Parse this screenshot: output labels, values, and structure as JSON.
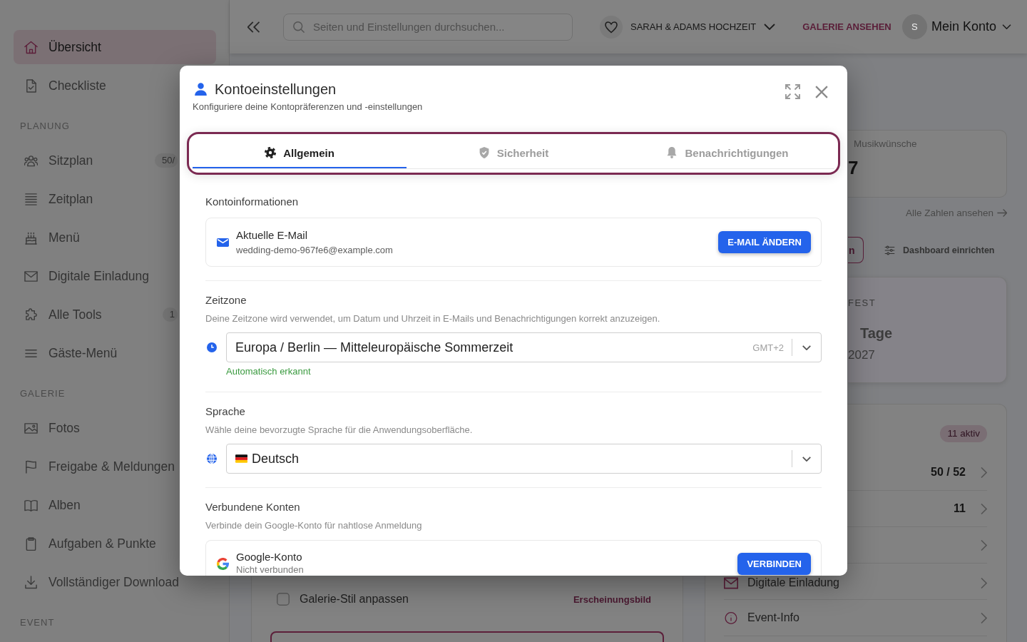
{
  "sidebar": {
    "sections": [
      {
        "items": [
          {
            "label": "Übersicht",
            "selected": true
          },
          {
            "label": "Checkliste",
            "selected": false
          }
        ]
      },
      {
        "heading": "PLANUNG",
        "items": [
          {
            "label": "Sitzplan",
            "selected": false,
            "badge": "50/"
          },
          {
            "label": "Zeitplan",
            "selected": false
          },
          {
            "label": "Menü",
            "selected": false
          },
          {
            "label": "Digitale Einladung",
            "selected": false
          },
          {
            "label": "Alle Tools",
            "selected": false,
            "badge": "1"
          },
          {
            "label": "Gäste-Menü",
            "selected": false
          }
        ]
      },
      {
        "heading": "GALERIE",
        "items": [
          {
            "label": "Fotos",
            "selected": false
          },
          {
            "label": "Freigabe & Meldungen",
            "selected": false
          },
          {
            "label": "Alben",
            "selected": false
          },
          {
            "label": "Aufgaben & Punkte",
            "selected": false
          },
          {
            "label": "Vollständiger Download",
            "selected": false
          }
        ]
      },
      {
        "heading": "EVENT"
      }
    ]
  },
  "topbar": {
    "search": {
      "placeholder": "Seiten und Einstellungen durchsuchen..."
    },
    "event": "SARAH & ADAMS HOCHZEIT",
    "gallery_link": "GALERIE ANSEHEN",
    "account": {
      "initial": "S",
      "label": "Mein Konto"
    }
  },
  "dashboard": {
    "stat": {
      "label": "Musikwünsche",
      "value": "7"
    },
    "all_stats_link": "Alle Zahlen ansehen",
    "partial_button": "n",
    "customize_button": "Dashboard einrichten",
    "countdown": {
      "label": "FEST",
      "unit": "Tage",
      "date": "2027"
    },
    "overview": {
      "badge": "11 aktiv",
      "rows": [
        {
          "value": "50 / 52"
        },
        {
          "value": "11"
        },
        {},
        {
          "label": "Digitale Einladung"
        },
        {
          "label": "Event-Info"
        }
      ]
    },
    "checklist_item": {
      "label": "Galerie-Stil anpassen",
      "checked": false,
      "tag": "Erscheinungsbild"
    }
  },
  "modal": {
    "title": "Kontoeinstellungen",
    "subtitle": "Konfiguriere deine Kontopräferenzen und -einstellungen",
    "tabs": [
      {
        "label": "Allgemein",
        "selected": true
      },
      {
        "label": "Sicherheit",
        "selected": false
      },
      {
        "label": "Benachrichtigungen",
        "selected": false
      }
    ],
    "sections": [
      {
        "kind": "account",
        "heading": "Kontoinformationen",
        "title": "Aktuelle E-Mail",
        "value": "wedding-demo-967fe6@example.com",
        "button": "E-MAIL ÄNDERN"
      },
      {
        "kind": "timezone",
        "heading": "Zeitzone",
        "description": "Deine Zeitzone wird verwendet, um Datum und Uhrzeit in E-Mails und Benachrichtigungen korrekt anzuzeigen.",
        "value": "Europa / Berlin — Mitteleuropäische Sommerzeit",
        "suffix": "GMT+2",
        "note": "Automatisch erkannt"
      },
      {
        "kind": "language",
        "heading": "Sprache",
        "description": "Wähle deine bevorzugte Sprache für die Anwendungsoberfläche.",
        "value": "Deutsch"
      },
      {
        "kind": "connect",
        "heading": "Verbundene Konten",
        "description": "Verbinde dein Google-Konto für nahtlose Anmeldung",
        "title": "Google-Konto",
        "status": "Nicht verbunden",
        "button": "VERBINDEN"
      }
    ]
  }
}
